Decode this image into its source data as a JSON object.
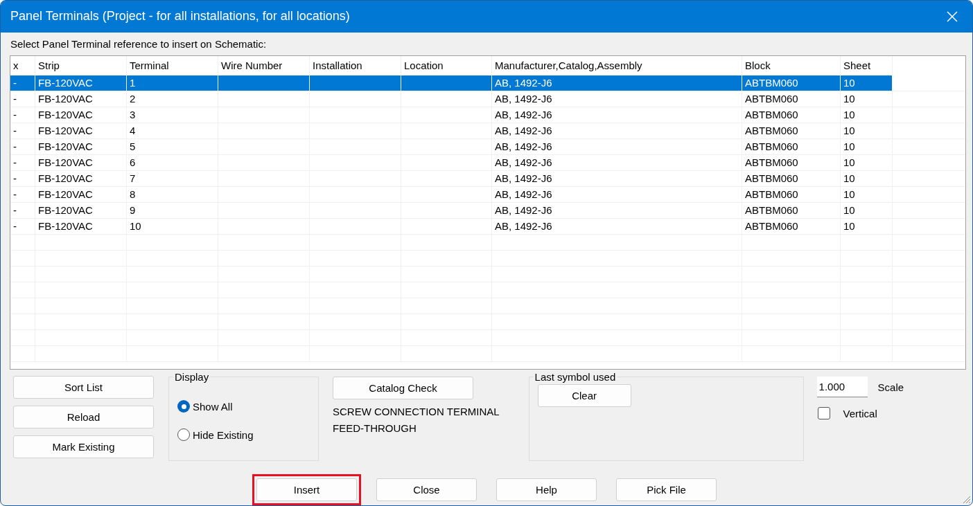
{
  "window": {
    "title": "Panel Terminals (Project - for all installations, for all locations)"
  },
  "prompt": "Select Panel Terminal reference to insert on Schematic:",
  "table": {
    "columns": [
      "x",
      "Strip",
      "Terminal",
      "Wire Number",
      "Installation",
      "Location",
      "Manufacturer,Catalog,Assembly",
      "Block",
      "Sheet"
    ],
    "rows": [
      {
        "selected": true,
        "cells": [
          "-",
          "FB-120VAC",
          "1",
          "",
          "",
          "",
          "AB, 1492-J6",
          "ABTBM060",
          "10"
        ]
      },
      {
        "selected": false,
        "cells": [
          "-",
          "FB-120VAC",
          "2",
          "",
          "",
          "",
          "AB, 1492-J6",
          "ABTBM060",
          "10"
        ]
      },
      {
        "selected": false,
        "cells": [
          "-",
          "FB-120VAC",
          "3",
          "",
          "",
          "",
          "AB, 1492-J6",
          "ABTBM060",
          "10"
        ]
      },
      {
        "selected": false,
        "cells": [
          "-",
          "FB-120VAC",
          "4",
          "",
          "",
          "",
          "AB, 1492-J6",
          "ABTBM060",
          "10"
        ]
      },
      {
        "selected": false,
        "cells": [
          "-",
          "FB-120VAC",
          "5",
          "",
          "",
          "",
          "AB, 1492-J6",
          "ABTBM060",
          "10"
        ]
      },
      {
        "selected": false,
        "cells": [
          "-",
          "FB-120VAC",
          "6",
          "",
          "",
          "",
          "AB, 1492-J6",
          "ABTBM060",
          "10"
        ]
      },
      {
        "selected": false,
        "cells": [
          "-",
          "FB-120VAC",
          "7",
          "",
          "",
          "",
          "AB, 1492-J6",
          "ABTBM060",
          "10"
        ]
      },
      {
        "selected": false,
        "cells": [
          "-",
          "FB-120VAC",
          "8",
          "",
          "",
          "",
          "AB, 1492-J6",
          "ABTBM060",
          "10"
        ]
      },
      {
        "selected": false,
        "cells": [
          "-",
          "FB-120VAC",
          "9",
          "",
          "",
          "",
          "AB, 1492-J6",
          "ABTBM060",
          "10"
        ]
      },
      {
        "selected": false,
        "cells": [
          "-",
          "FB-120VAC",
          "10",
          "",
          "",
          "",
          "AB, 1492-J6",
          "ABTBM060",
          "10"
        ]
      }
    ]
  },
  "left_buttons": [
    "Sort List",
    "Reload",
    "Mark Existing"
  ],
  "display": {
    "legend": "Display",
    "options": [
      {
        "label": "Show All",
        "selected": true
      },
      {
        "label": "Hide Existing",
        "selected": false
      }
    ]
  },
  "catalog": {
    "button": "Catalog Check",
    "description": [
      "SCREW CONNECTION TERMINAL",
      "FEED-THROUGH"
    ]
  },
  "last_symbol": {
    "legend": "Last symbol used",
    "button": "Clear"
  },
  "scale": {
    "value": "1.000",
    "label": "Scale"
  },
  "vertical": {
    "label": "Vertical",
    "checked": false
  },
  "bottom_buttons": [
    {
      "label": "Insert",
      "highlighted": true
    },
    {
      "label": "Close",
      "highlighted": false
    },
    {
      "label": "Help",
      "highlighted": false
    },
    {
      "label": "Pick File",
      "highlighted": false
    }
  ]
}
